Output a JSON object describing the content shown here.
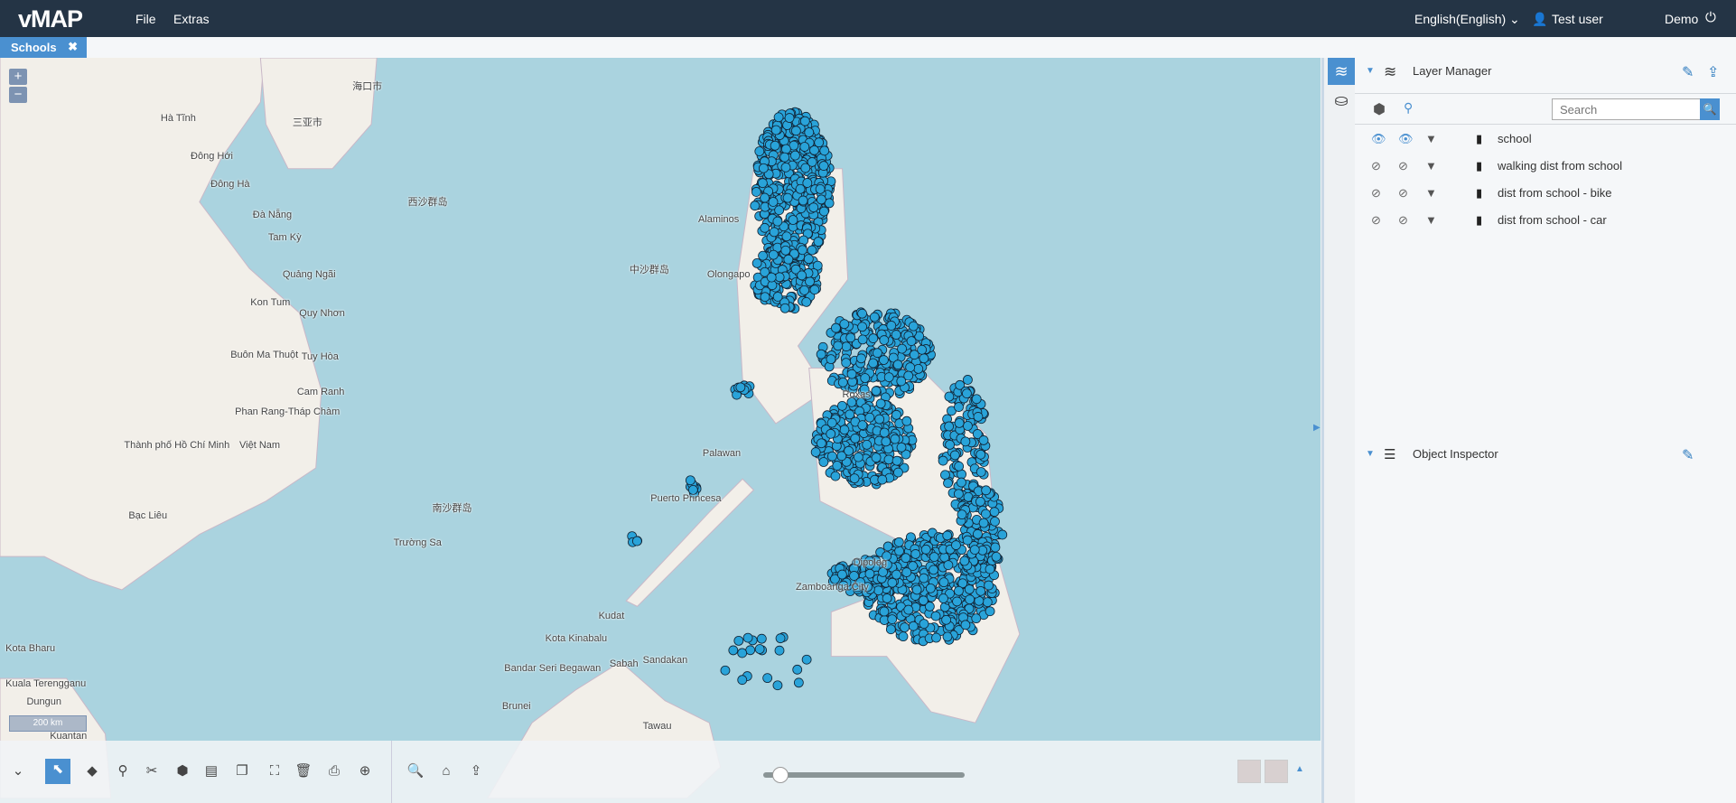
{
  "header": {
    "logo": "vMAP",
    "menu": [
      "File",
      "Extras"
    ],
    "language": "English(English) ⌄",
    "user": "Test user",
    "demo": "Demo"
  },
  "tab": {
    "label": "Schools",
    "close": "✖"
  },
  "map": {
    "zoom_in": "+",
    "zoom_out": "−",
    "scale": "200 km",
    "labels": [
      "Đà Nẵng",
      "Hà Tĩnh",
      "Đông Hới",
      "Đông Hà",
      "Tam Kỳ",
      "Quảng Ngãi",
      "Kon Tum",
      "Quy Nhơn",
      "Buôn Ma Thuột",
      "Tuy Hòa",
      "Cam Ranh",
      "Phan Rang-Tháp Chàm",
      "Thành phố Hồ Chí Minh",
      "Việt Nam",
      "Bạc Liêu",
      "西沙群岛",
      "中沙群岛",
      "南沙群岛",
      "Trường Sa",
      "三亚市",
      "海口市",
      "Puerto Princesa",
      "Palawan",
      "Zamboanga City",
      "Kota Kinabalu",
      "Bandar Seri Begawan",
      "Brunei",
      "Sandakan",
      "Kudat",
      "Tawau",
      "Sabah",
      "Roxas",
      "Dipolog",
      "Alaminos",
      "Olongapo",
      "Kota Bharu",
      "Kuala Terengganu",
      "Dungun",
      "Kuantan"
    ],
    "point_color": "#29a3d9"
  },
  "toolbar": {
    "tools": [
      "collapse",
      "select",
      "draw",
      "point",
      "split",
      "polygon",
      "measure",
      "copy",
      "map-edit",
      "delete",
      "print",
      "zoom-area",
      "search",
      "home",
      "share"
    ],
    "active": "select"
  },
  "panel": {
    "layer_manager": "Layer Manager",
    "search_placeholder": "Search",
    "layers": [
      {
        "name": "school",
        "visible": true
      },
      {
        "name": "walking dist from school",
        "visible": false
      },
      {
        "name": "dist from school - bike",
        "visible": false
      },
      {
        "name": "dist from school - car",
        "visible": false
      }
    ],
    "object_inspector": "Object Inspector"
  },
  "colors": {
    "header": "#243445",
    "accent": "#4a90d0",
    "sea": "#aad3df",
    "land": "#f2efe9"
  }
}
